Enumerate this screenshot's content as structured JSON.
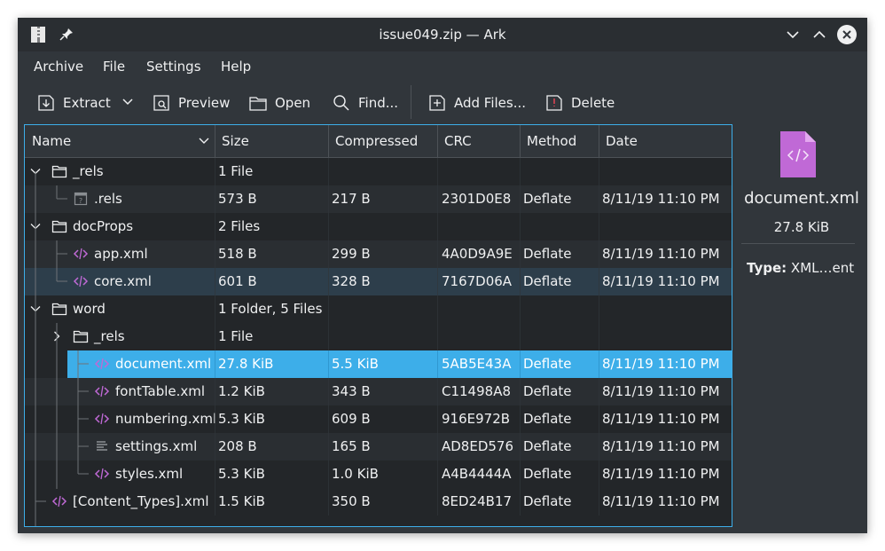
{
  "window": {
    "title": "issue049.zip — Ark"
  },
  "menu": [
    "Archive",
    "File",
    "Settings",
    "Help"
  ],
  "toolbar": {
    "extract": "Extract",
    "preview": "Preview",
    "open": "Open",
    "find": "Find...",
    "add_files": "Add Files...",
    "delete": "Delete"
  },
  "columns": [
    "Name",
    "Size",
    "Compressed",
    "CRC",
    "Method",
    "Date"
  ],
  "rows": [
    {
      "name": "_rels",
      "size": "1 File",
      "compressed": "",
      "crc": "",
      "method": "",
      "date": "",
      "icon": "folder-icon",
      "expander": "expanded"
    },
    {
      "name": ".rels",
      "size": "573 B",
      "compressed": "217 B",
      "crc": "2301D0E8",
      "method": "Deflate",
      "date": "8/11/19 11:10 PM",
      "icon": "unknown-file-icon"
    },
    {
      "name": "docProps",
      "size": "2 Files",
      "compressed": "",
      "crc": "",
      "method": "",
      "date": "",
      "icon": "folder-icon",
      "expander": "expanded"
    },
    {
      "name": "app.xml",
      "size": "518 B",
      "compressed": "299 B",
      "crc": "4A0D9A9E",
      "method": "Deflate",
      "date": "8/11/19 11:10 PM",
      "icon": "xml-file-icon"
    },
    {
      "name": "core.xml",
      "size": "601 B",
      "compressed": "328 B",
      "crc": "7167D06A",
      "method": "Deflate",
      "date": "8/11/19 11:10 PM",
      "icon": "xml-file-icon"
    },
    {
      "name": "word",
      "size": "1 Folder, 5 Files",
      "compressed": "",
      "crc": "",
      "method": "",
      "date": "",
      "icon": "folder-icon",
      "expander": "expanded"
    },
    {
      "name": "_rels",
      "size": "1 File",
      "compressed": "",
      "crc": "",
      "method": "",
      "date": "",
      "icon": "folder-icon",
      "expander": "collapsed"
    },
    {
      "name": "document.xml",
      "size": "27.8 KiB",
      "compressed": "5.5 KiB",
      "crc": "5AB5E43A",
      "method": "Deflate",
      "date": "8/11/19 11:10 PM",
      "icon": "xml-file-icon"
    },
    {
      "name": "fontTable.xml",
      "size": "1.2 KiB",
      "compressed": "343 B",
      "crc": "C11498A8",
      "method": "Deflate",
      "date": "8/11/19 11:10 PM",
      "icon": "xml-file-icon"
    },
    {
      "name": "numbering.xml",
      "size": "5.3 KiB",
      "compressed": "609 B",
      "crc": "916E972B",
      "method": "Deflate",
      "date": "8/11/19 11:10 PM",
      "icon": "xml-file-icon"
    },
    {
      "name": "settings.xml",
      "size": "208 B",
      "compressed": "165 B",
      "crc": "AD8ED576",
      "method": "Deflate",
      "date": "8/11/19 11:10 PM",
      "icon": "text-file-icon"
    },
    {
      "name": "styles.xml",
      "size": "5.3 KiB",
      "compressed": "1.0 KiB",
      "crc": "A4B4444A",
      "method": "Deflate",
      "date": "8/11/19 11:10 PM",
      "icon": "xml-file-icon"
    },
    {
      "name": "[Content_Types].xml",
      "size": "1.5 KiB",
      "compressed": "350 B",
      "crc": "8ED24B17",
      "method": "Deflate",
      "date": "8/11/19 11:10 PM",
      "icon": "xml-file-icon"
    }
  ],
  "selected_row": "document.xml",
  "details": {
    "file_name": "document.xml",
    "file_size": "27.8 KiB",
    "type_label": "Type:",
    "type_value": "XML…ent",
    "icon": "xml-document-icon"
  },
  "colors": {
    "accent": "#3daee9",
    "window_bg": "#31363b",
    "view_bg": "#232629",
    "xml_icon": "#c069d6"
  }
}
